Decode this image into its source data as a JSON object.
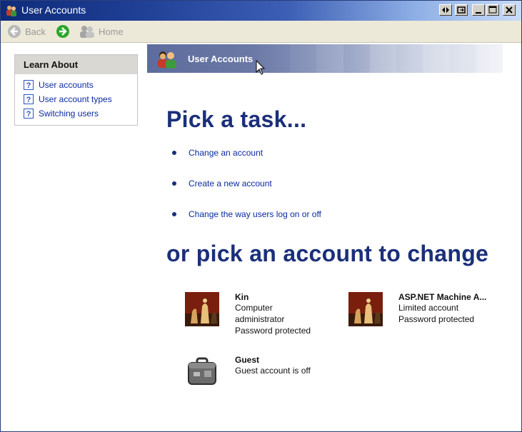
{
  "window": {
    "title": "User Accounts"
  },
  "toolbar": {
    "back_label": "Back",
    "home_label": "Home"
  },
  "learn_about": {
    "heading": "Learn About",
    "items": [
      {
        "label": "User accounts"
      },
      {
        "label": "User account types"
      },
      {
        "label": "Switching users"
      }
    ]
  },
  "banner": {
    "title": "User Accounts"
  },
  "tasks": {
    "heading": "Pick a task...",
    "items": [
      {
        "label": "Change an account"
      },
      {
        "label": "Create a new account"
      },
      {
        "label": "Change the way users log on or off"
      }
    ]
  },
  "accounts": {
    "heading": "or pick an account to change",
    "items": [
      {
        "name": "Kin",
        "lines": [
          "Computer",
          "administrator",
          "Password protected"
        ],
        "icon": "chess-icon"
      },
      {
        "name": "ASP.NET Machine A...",
        "lines": [
          "Limited account",
          "Password protected"
        ],
        "icon": "chess-icon"
      },
      {
        "name": "Guest",
        "lines": [
          "Guest account is off"
        ],
        "icon": "suitcase-icon"
      }
    ]
  },
  "colors": {
    "accent": "#1b2f7a",
    "link": "#0a2ba0",
    "title_bar": "#1e3e94"
  }
}
